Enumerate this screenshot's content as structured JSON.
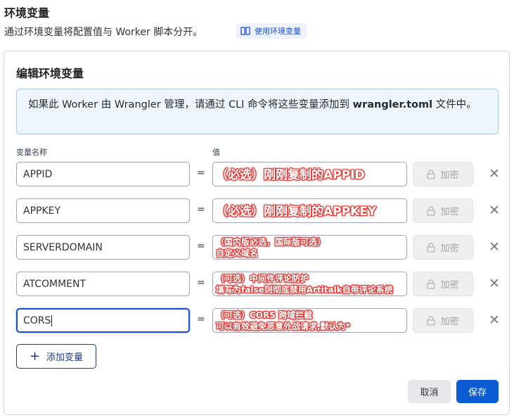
{
  "section": {
    "title": "环境变量",
    "description": "通过环境变量将配置值与 Worker 脚本分开。",
    "docs_link": "使用环境变量"
  },
  "panel": {
    "title": "编辑环境变量",
    "info_prefix": "如果此 Worker 由 Wrangler 管理，请通过 CLI 命令将这些变量添加到 ",
    "info_file": "wrangler.toml",
    "info_suffix": " 文件中。",
    "col_name": "变量名称",
    "col_value": "值"
  },
  "rows": [
    {
      "name": "APPID",
      "eq": "=",
      "annotation": [
        "（必选）刚刚复制的APPID"
      ],
      "encrypt": "加密"
    },
    {
      "name": "APPKEY",
      "eq": "=",
      "annotation": [
        "（必选）刚刚复制的APPKEY"
      ],
      "encrypt": "加密"
    },
    {
      "name": "SERVERDOMAIN",
      "eq": "=",
      "annotation": [
        "（国内版必选，国际版可选）",
        "自定义域名"
      ],
      "encrypt": "加密"
    },
    {
      "name": "ATCOMMENT",
      "eq": "=",
      "annotation": [
        "（可选）中间件评论防护",
        "填写为false则彻底禁用Artitalk自带评论系统"
      ],
      "encrypt": "加密"
    },
    {
      "name": "CORS",
      "eq": "=",
      "annotation": [
        "（可选）CORS 跨域拦截",
        "可以有效避免恶意外战请求,默认为*"
      ],
      "encrypt": "加密"
    }
  ],
  "buttons": {
    "add": "添加变量",
    "cancel": "取消",
    "save": "保存"
  },
  "icons": {
    "docs": "book-icon",
    "lock": "lock-icon",
    "remove": "close-icon",
    "add": "plus-icon"
  },
  "colors": {
    "primary": "#0b5bd3",
    "annotation": "#e53935",
    "info_bg": "#eef6fd"
  }
}
